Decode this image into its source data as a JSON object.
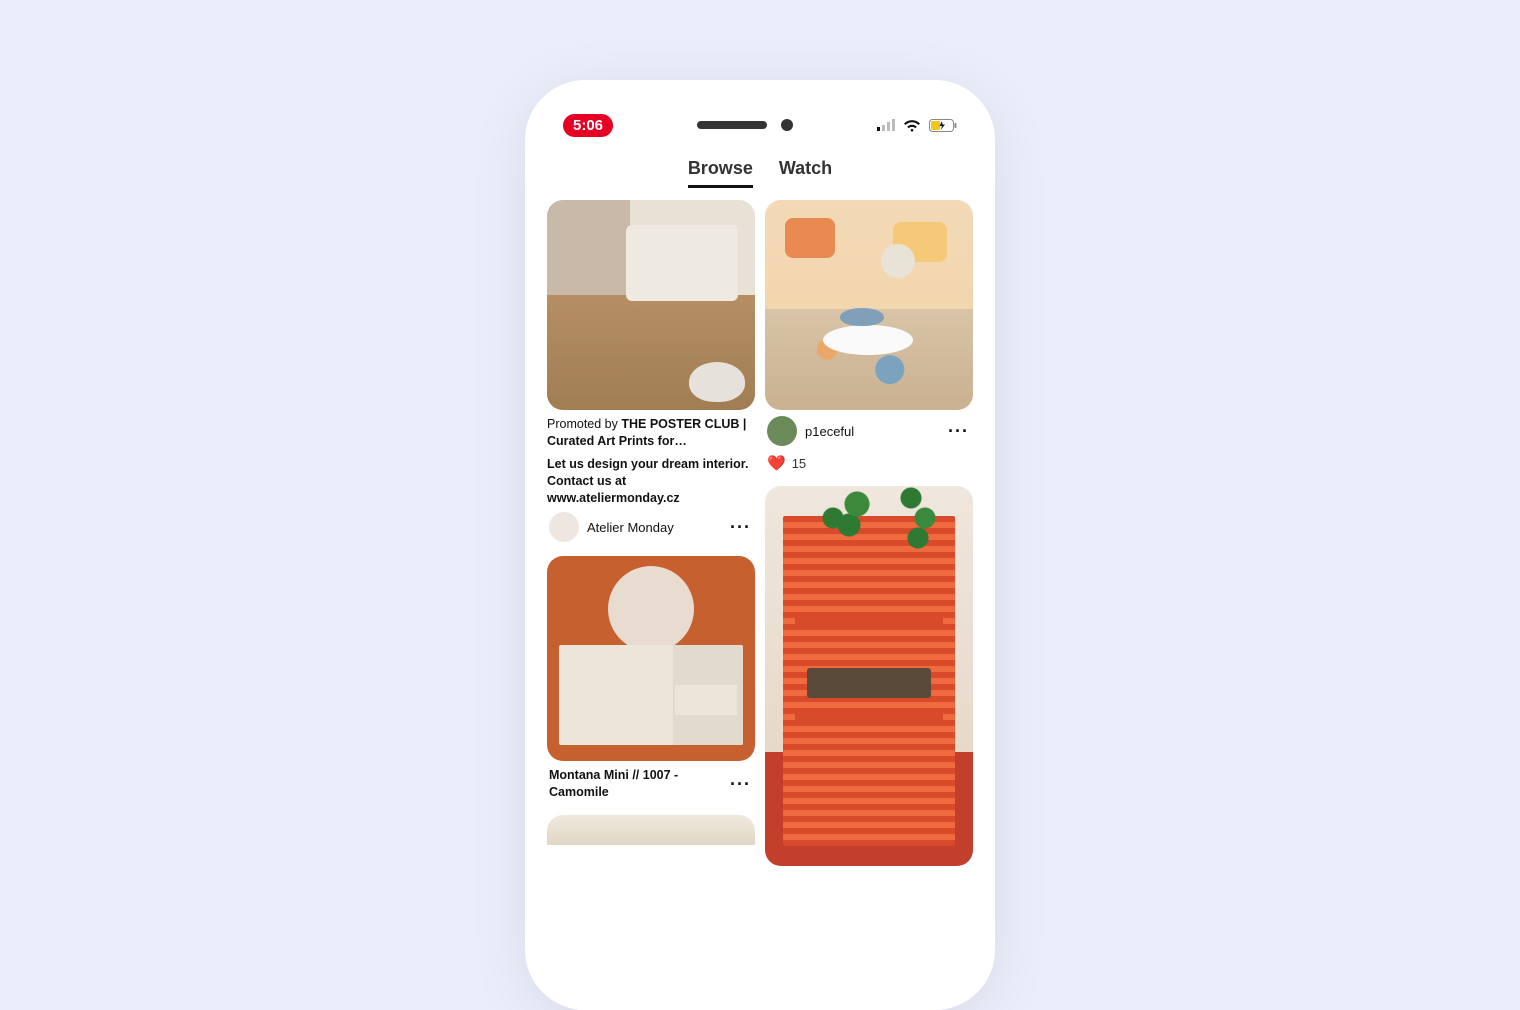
{
  "statusbar": {
    "time": "5:06"
  },
  "tabs": {
    "browse": "Browse",
    "watch": "Watch"
  },
  "pins": {
    "p1": {
      "promoted_prefix": "Promoted by ",
      "promoted_name": "THE POSTER CLUB | Curated Art Prints for…",
      "description": "Let us design your dream interior. Contact us at www.ateliermonday.cz",
      "author": "Atelier Monday"
    },
    "p2": {
      "author": "p1eceful",
      "reaction_count": "15"
    },
    "p3": {
      "title": "Montana Mini // 1007 - Camomile"
    }
  }
}
